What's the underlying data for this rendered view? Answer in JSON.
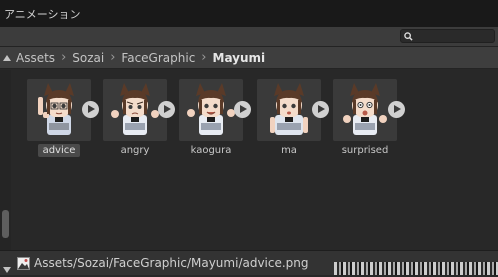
{
  "window": {
    "tab_title": "アニメーション"
  },
  "breadcrumb": [
    "Assets",
    "Sozai",
    "FaceGraphic",
    "Mayumi"
  ],
  "assets": [
    {
      "label": "advice",
      "selected": true,
      "pose": "finger-up"
    },
    {
      "label": "angry",
      "selected": false,
      "pose": "fists-up"
    },
    {
      "label": "kaogura",
      "selected": false,
      "pose": "fists-up"
    },
    {
      "label": "ma",
      "selected": false,
      "pose": "arms-down"
    },
    {
      "label": "surprised",
      "selected": false,
      "pose": "hands-raised"
    }
  ],
  "status": {
    "path": "Assets/Sozai/FaceGraphic/Mayumi/advice.png",
    "icon": "texture-icon"
  },
  "icons": {
    "search": "search-icon",
    "play": "play-icon",
    "collapse": "triangle-icon"
  },
  "colors": {
    "background": "#282828",
    "toolbar": "#3c3c3c",
    "label_text": "#c8c8c8"
  }
}
